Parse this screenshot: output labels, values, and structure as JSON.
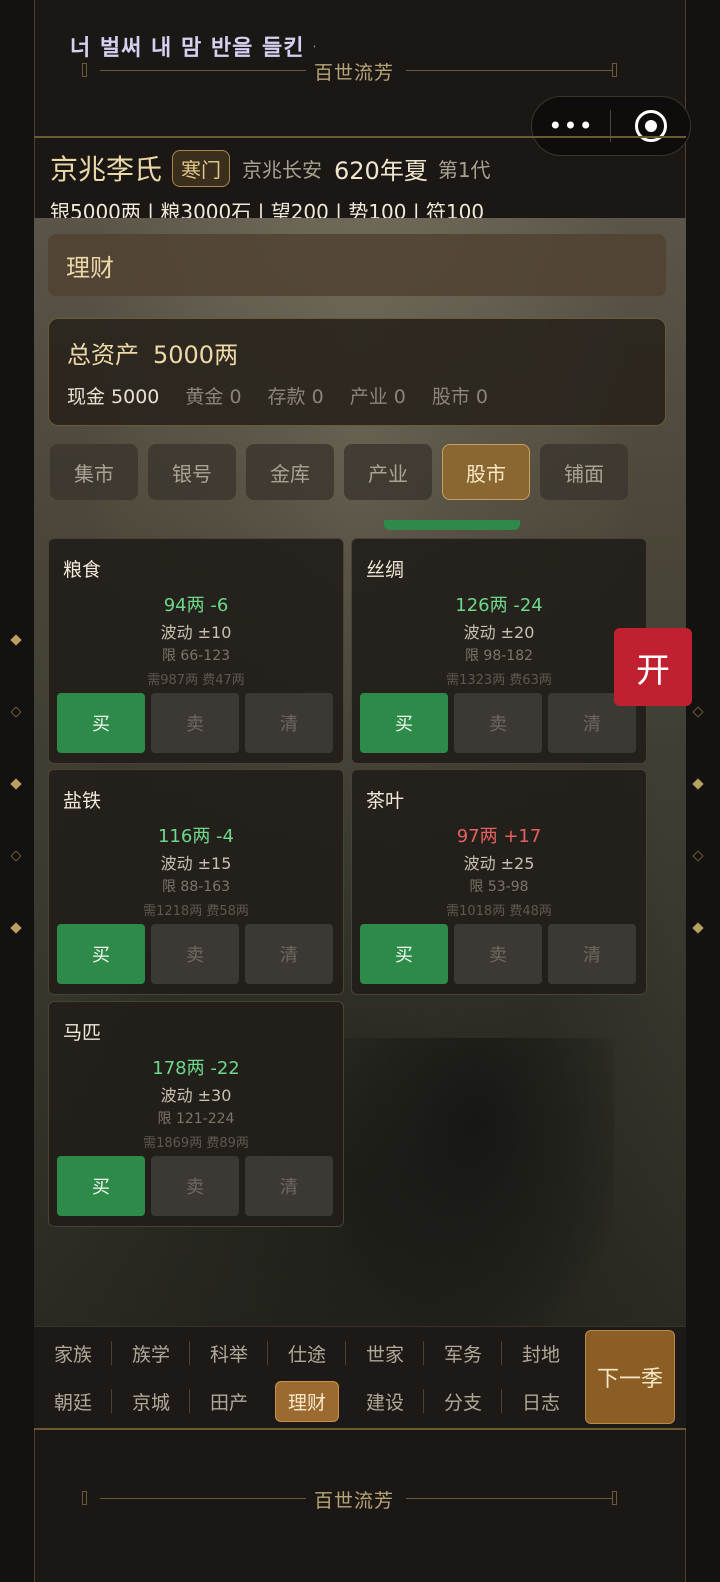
{
  "app": {
    "marquee": "너 벌써 내 맘 반을 들킨 걸",
    "frame_title": "百世流芳"
  },
  "capsule": {
    "more": "•••"
  },
  "family": {
    "name": "京兆李氏",
    "rank": "寒门",
    "location": "京兆长安",
    "year": "620年夏",
    "generation": "第1代"
  },
  "resources": "银5000两 | 粮3000石 | 望200 | 势100 | 符100",
  "panel": {
    "title": "理财",
    "total_label": "总资产",
    "total_value": "5000两",
    "assets": [
      {
        "label": "现金 5000"
      },
      {
        "label": "黄金 0"
      },
      {
        "label": "存款 0"
      },
      {
        "label": "产业 0"
      },
      {
        "label": "股市 0"
      }
    ]
  },
  "tabs": [
    {
      "label": "集市"
    },
    {
      "label": "银号"
    },
    {
      "label": "金库"
    },
    {
      "label": "产业"
    },
    {
      "label": "股市",
      "active": true
    },
    {
      "label": "铺面"
    }
  ],
  "stocks": [
    {
      "name": "粮食",
      "price": "94两 -6",
      "trend": "down",
      "vol": "波动 ±10",
      "limit": "限 66-123",
      "fee": "需987两 费47两"
    },
    {
      "name": "丝绸",
      "price": "126两 -24",
      "trend": "down",
      "vol": "波动 ±20",
      "limit": "限 98-182",
      "fee": "需1323两 费63两"
    },
    {
      "name": "盐铁",
      "price": "116两 -4",
      "trend": "down",
      "vol": "波动 ±15",
      "limit": "限 88-163",
      "fee": "需1218两 费58两"
    },
    {
      "name": "茶叶",
      "price": "97两 +17",
      "trend": "up",
      "vol": "波动 ±25",
      "limit": "限 53-98",
      "fee": "需1018两 费48两"
    },
    {
      "name": "马匹",
      "price": "178两 -22",
      "trend": "down",
      "vol": "波动 ±30",
      "limit": "限 121-224",
      "fee": "需1869两 费89两"
    }
  ],
  "trade_buttons": {
    "buy": "买",
    "sell": "卖",
    "clear": "清"
  },
  "float_button": "开",
  "nav": {
    "row1": [
      "家族",
      "族学",
      "科举",
      "仕途",
      "世家",
      "军务",
      "封地"
    ],
    "row2": [
      "朝廷",
      "京城",
      "田产",
      "理财",
      "建设",
      "分支",
      "日志"
    ],
    "active": "理财",
    "next_season": "下一季"
  },
  "colors": {
    "accent_gold": "#8a6630",
    "buy_green": "#2e8a48",
    "price_down": "#6ed88a",
    "price_up": "#e86060",
    "open_red": "#c02030"
  }
}
